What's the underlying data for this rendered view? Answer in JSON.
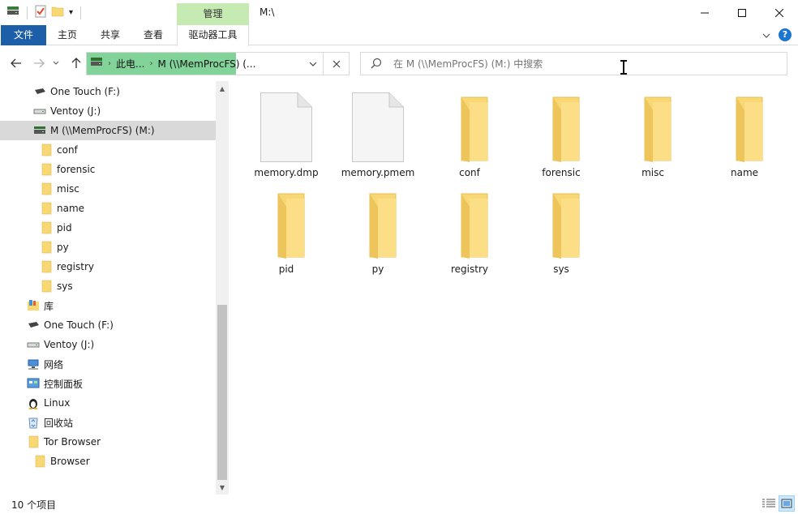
{
  "title_bar": {
    "manage_tab": "管理",
    "window_title": "M:\\"
  },
  "ribbon": {
    "tabs": [
      "文件",
      "主页",
      "共享",
      "查看",
      "驱动器工具"
    ]
  },
  "address": {
    "crumbs": [
      "此电...",
      "M (\\\\MemProcFS) (..."
    ],
    "search_placeholder": "在 M (\\\\MemProcFS) (M:) 中搜索"
  },
  "sidebar": {
    "items": [
      {
        "label": "One Touch (F:)",
        "icon": "drive-icon"
      },
      {
        "label": "Ventoy (J:)",
        "icon": "usb-drive-icon"
      },
      {
        "label": "M (\\\\MemProcFS) (M:)",
        "icon": "network-drive-icon",
        "selected": true
      },
      {
        "label": "conf",
        "icon": "folder-icon"
      },
      {
        "label": "forensic",
        "icon": "folder-icon"
      },
      {
        "label": "misc",
        "icon": "folder-icon"
      },
      {
        "label": "name",
        "icon": "folder-icon"
      },
      {
        "label": "pid",
        "icon": "folder-icon"
      },
      {
        "label": "py",
        "icon": "folder-icon"
      },
      {
        "label": "registry",
        "icon": "folder-icon"
      },
      {
        "label": "sys",
        "icon": "folder-icon"
      },
      {
        "label": "库",
        "icon": "library-icon"
      },
      {
        "label": "One Touch (F:)",
        "icon": "drive-icon"
      },
      {
        "label": "Ventoy (J:)",
        "icon": "usb-drive-icon"
      },
      {
        "label": "网络",
        "icon": "network-icon"
      },
      {
        "label": "控制面板",
        "icon": "control-panel-icon"
      },
      {
        "label": "Linux",
        "icon": "linux-icon"
      },
      {
        "label": "回收站",
        "icon": "recycle-bin-icon"
      },
      {
        "label": "Tor Browser",
        "icon": "folder-icon"
      },
      {
        "label": "Browser",
        "icon": "folder-icon"
      }
    ]
  },
  "files": [
    {
      "name": "memory.dmp",
      "type": "file"
    },
    {
      "name": "memory.pmem",
      "type": "file"
    },
    {
      "name": "conf",
      "type": "folder"
    },
    {
      "name": "forensic",
      "type": "folder"
    },
    {
      "name": "misc",
      "type": "folder"
    },
    {
      "name": "name",
      "type": "folder"
    },
    {
      "name": "pid",
      "type": "folder"
    },
    {
      "name": "py",
      "type": "folder"
    },
    {
      "name": "registry",
      "type": "folder"
    },
    {
      "name": "sys",
      "type": "folder"
    }
  ],
  "status": {
    "item_count": "10 个项目"
  },
  "colors": {
    "accent": "#1c5ea8",
    "manage_tab": "#c5ebb3",
    "address_highlight": "#82d39a",
    "folder": "#f8d775",
    "selected_row": "#d9d9d9"
  }
}
